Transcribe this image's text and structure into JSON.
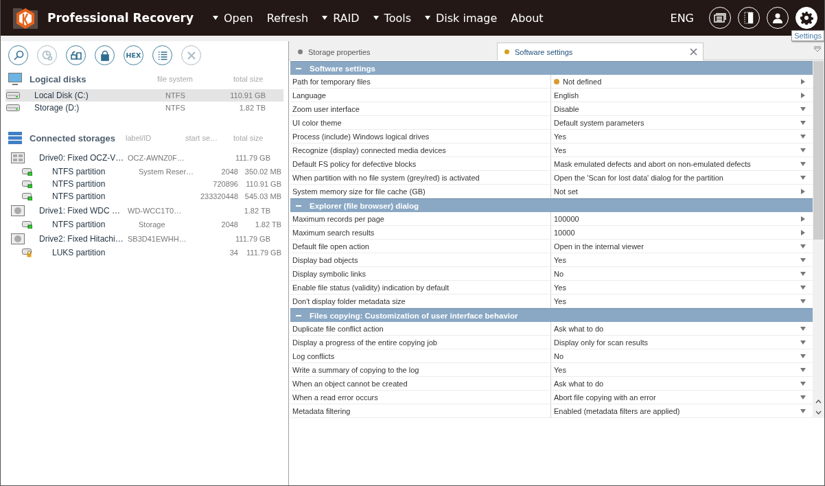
{
  "header": {
    "title": "Professional Recovery",
    "menu": [
      {
        "label": "Open",
        "dropdown": true
      },
      {
        "label": "Refresh",
        "dropdown": false
      },
      {
        "label": "RAID",
        "dropdown": true
      },
      {
        "label": "Tools",
        "dropdown": true
      },
      {
        "label": "Disk image",
        "dropdown": true
      },
      {
        "label": "About",
        "dropdown": false
      }
    ],
    "language": "ENG",
    "icons": [
      {
        "kind": "windows",
        "selected": false
      },
      {
        "kind": "panel",
        "selected": false
      },
      {
        "kind": "user",
        "selected": false
      },
      {
        "kind": "settings",
        "selected": true
      }
    ],
    "tooltip": "Settings"
  },
  "toolbar": [
    {
      "kind": "search",
      "disabled": false
    },
    {
      "kind": "chart",
      "disabled": true
    },
    {
      "kind": "transfer",
      "disabled": false
    },
    {
      "kind": "lock",
      "disabled": false
    },
    {
      "kind": "hex",
      "label": "HEX",
      "disabled": false
    },
    {
      "kind": "list",
      "disabled": false
    },
    {
      "kind": "close",
      "disabled": true
    }
  ],
  "logical_disks": {
    "title": "Logical disks",
    "columns": [
      "file system",
      "total size"
    ],
    "rows": [
      {
        "name": "Local Disk (C:)",
        "file_system": "NTFS",
        "total_size": "110.91 GB",
        "selected": true
      },
      {
        "name": "Storage (D:)",
        "file_system": "NTFS",
        "total_size": "1.82 TB",
        "selected": false
      }
    ]
  },
  "connected_storages": {
    "title": "Connected storages",
    "columns": [
      "label/ID",
      "start se…",
      "total size"
    ],
    "drives": [
      {
        "name": "Drive0: Fixed OCZ-V…",
        "kind": "ssd",
        "label": "OCZ-AWNZ0F…",
        "total_size": "111.79 GB",
        "children": [
          {
            "name": "NTFS partition",
            "kind": "partition",
            "label": "System Reser…",
            "start": "2048",
            "total_size": "350.02 MB"
          },
          {
            "name": "NTFS partition",
            "kind": "partition",
            "start": "720896",
            "total_size": "110.91 GB"
          },
          {
            "name": "NTFS partition",
            "kind": "partition",
            "start": "233320448",
            "total_size": "545.03 MB"
          }
        ]
      },
      {
        "name": "Drive1: Fixed WDC …",
        "kind": "hdd",
        "label": "WD-WCC1T0…",
        "total_size": "1.82 TB",
        "children": [
          {
            "name": "NTFS partition",
            "kind": "partition",
            "label": "Storage",
            "start": "2048",
            "total_size": "1.82 TB"
          }
        ]
      },
      {
        "name": "Drive2: Fixed Hitachi…",
        "kind": "hdd",
        "label": "SB3D41EWHH…",
        "total_size": "111.79 GB",
        "children": [
          {
            "name": "LUKS partition",
            "kind": "locked",
            "start": "34",
            "total_size": "111.79 GB"
          }
        ]
      }
    ]
  },
  "tabs": [
    {
      "label": "Storage properties",
      "selected": false,
      "color": "#808080"
    },
    {
      "label": "Software settings",
      "selected": true,
      "color": "#d4a020"
    }
  ],
  "sections": [
    {
      "title": "Software settings",
      "expanded": true,
      "rows": [
        {
          "name": "Path for temporary files",
          "value": "Not defined",
          "kind": "submenu",
          "warning": true
        },
        {
          "name": "Language",
          "value": "English",
          "kind": "submenu",
          "warning": false
        },
        {
          "name": "Zoom user interface",
          "value": "Disable",
          "kind": "dropdown",
          "warning": false
        },
        {
          "name": "UI color theme",
          "value": "Default system parameters",
          "kind": "dropdown",
          "warning": false
        },
        {
          "name": "Process (include) Windows logical drives",
          "value": "Yes",
          "kind": "dropdown",
          "warning": false
        },
        {
          "name": "Recognize (display) connected media devices",
          "value": "Yes",
          "kind": "dropdown",
          "warning": false
        },
        {
          "name": "Default FS policy for defective blocks",
          "value": "Mask emulated defects and abort on non-emulated defects",
          "kind": "dropdown",
          "warning": false
        },
        {
          "name": "When partition with no file system (grey/red) is activated",
          "value": "Open the 'Scan for lost data' dialog for the partition",
          "kind": "dropdown",
          "warning": false
        },
        {
          "name": "System memory size for file cache (GB)",
          "value": "Not set",
          "kind": "submenu",
          "warning": false
        }
      ]
    },
    {
      "title": "Explorer (file browser) dialog",
      "expanded": true,
      "rows": [
        {
          "name": "Maximum records per page",
          "value": "100000",
          "kind": "submenu",
          "warning": false
        },
        {
          "name": "Maximum search results",
          "value": "10000",
          "kind": "submenu",
          "warning": false
        },
        {
          "name": "Default file open action",
          "value": "Open in the internal viewer",
          "kind": "dropdown",
          "warning": false
        },
        {
          "name": "Display bad objects",
          "value": "Yes",
          "kind": "dropdown",
          "warning": false
        },
        {
          "name": "Display symbolic links",
          "value": "No",
          "kind": "dropdown",
          "warning": false
        },
        {
          "name": "Enable file status (validity) indication by default",
          "value": "Yes",
          "kind": "dropdown",
          "warning": false
        },
        {
          "name": "Don't display folder metadata size",
          "value": "Yes",
          "kind": "dropdown",
          "warning": false
        }
      ]
    },
    {
      "title": "Files copying: Customization of user interface behavior",
      "expanded": true,
      "rows": [
        {
          "name": "Duplicate file conflict action",
          "value": "Ask what to do",
          "kind": "dropdown",
          "warning": false
        },
        {
          "name": "Display a progress of the entire copying job",
          "value": "Display only for scan results",
          "kind": "dropdown",
          "warning": false
        },
        {
          "name": "Log conflicts",
          "value": "No",
          "kind": "dropdown",
          "warning": false
        },
        {
          "name": "Write a summary of copying to the log",
          "value": "Yes",
          "kind": "dropdown",
          "warning": false
        },
        {
          "name": "When an object cannot be created",
          "value": "Ask what to do",
          "kind": "dropdown",
          "warning": false
        },
        {
          "name": "When a read error occurs",
          "value": "Abort file copying with an error",
          "kind": "dropdown",
          "warning": false
        },
        {
          "name": "Metadata filtering",
          "value": "Enabled (metadata filters are applied)",
          "kind": "dropdown",
          "warning": false
        }
      ]
    }
  ]
}
